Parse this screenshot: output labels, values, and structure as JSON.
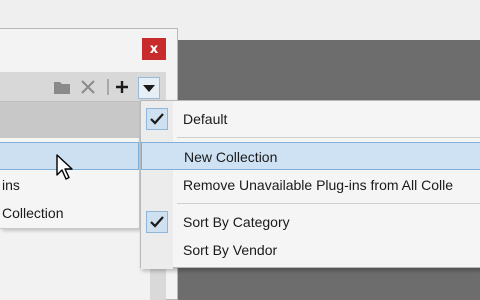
{
  "window": {
    "close_label": "x"
  },
  "toolbar": {
    "icons": [
      "folder-icon",
      "delete-icon",
      "add-icon",
      "dropdown-arrow-icon"
    ]
  },
  "submenu": {
    "items": [
      {
        "label": ""
      },
      {
        "label": "ins"
      },
      {
        "label": " Collection"
      }
    ]
  },
  "menu": {
    "items": [
      {
        "label": "Default",
        "checked": true
      },
      {
        "label": "New Collection",
        "checked": false,
        "highlighted": true
      },
      {
        "label": "Remove Unavailable Plug-ins from All Colle",
        "checked": false
      },
      {
        "label": "Sort By Category",
        "checked": true
      },
      {
        "label": "Sort By Vendor",
        "checked": false
      }
    ]
  }
}
